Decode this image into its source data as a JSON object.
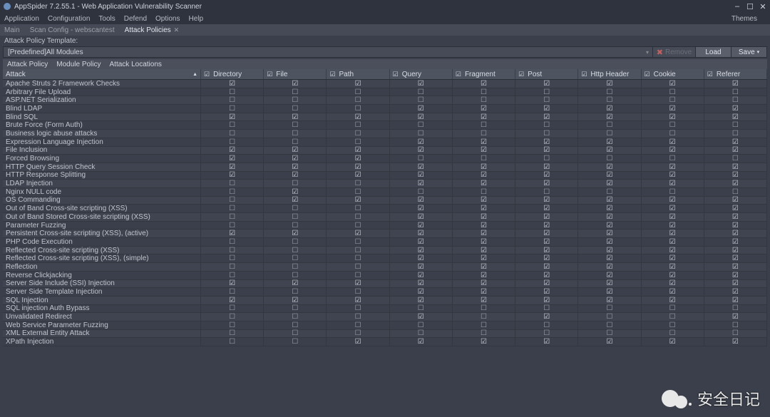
{
  "window": {
    "title": "AppSpider 7.2.55.1 - Web Application Vulnerability Scanner",
    "menus": [
      "Application",
      "Configuration",
      "Tools",
      "Defend",
      "Options",
      "Help"
    ],
    "themes_label": "Themes"
  },
  "tabs": [
    {
      "label": "Main",
      "active": false,
      "closable": false
    },
    {
      "label": "Scan Config - webscantest",
      "active": false,
      "closable": false
    },
    {
      "label": "Attack Policies",
      "active": true,
      "closable": true
    }
  ],
  "template": {
    "label": "Attack Policy Template:",
    "selected": "[Predefined]All Modules",
    "remove_label": "Remove",
    "load_label": "Load",
    "save_label": "Save"
  },
  "subtabs": [
    "Attack Policy",
    "Module Policy",
    "Attack Locations"
  ],
  "grid": {
    "attack_header": "Attack",
    "columns": [
      "Directory",
      "File",
      "Path",
      "Query",
      "Fragment",
      "Post",
      "Http Header",
      "Cookie",
      "Referer"
    ],
    "rows": [
      {
        "name": "Apache Struts 2 Framework Checks",
        "cells": [
          1,
          1,
          1,
          1,
          1,
          1,
          1,
          1,
          1
        ]
      },
      {
        "name": "Arbitrary File Upload",
        "cells": [
          0,
          0,
          0,
          0,
          0,
          0,
          0,
          0,
          0
        ]
      },
      {
        "name": "ASP.NET Serialization",
        "cells": [
          0,
          0,
          0,
          0,
          0,
          0,
          0,
          0,
          0
        ]
      },
      {
        "name": "Blind LDAP",
        "cells": [
          0,
          0,
          0,
          1,
          1,
          1,
          1,
          1,
          1
        ]
      },
      {
        "name": "Blind SQL",
        "cells": [
          1,
          1,
          1,
          1,
          1,
          1,
          1,
          1,
          1
        ]
      },
      {
        "name": "Brute Force (Form Auth)",
        "cells": [
          0,
          0,
          0,
          0,
          0,
          0,
          0,
          0,
          0
        ]
      },
      {
        "name": "Business logic abuse attacks",
        "cells": [
          0,
          0,
          0,
          0,
          0,
          0,
          0,
          0,
          0
        ]
      },
      {
        "name": "Expression Language Injection",
        "cells": [
          0,
          0,
          0,
          1,
          1,
          1,
          1,
          1,
          1
        ]
      },
      {
        "name": "File Inclusion",
        "cells": [
          1,
          1,
          1,
          1,
          1,
          1,
          1,
          1,
          1
        ]
      },
      {
        "name": "Forced Browsing",
        "cells": [
          1,
          1,
          1,
          0,
          0,
          0,
          0,
          0,
          0
        ]
      },
      {
        "name": "HTTP Query Session Check",
        "cells": [
          1,
          1,
          1,
          1,
          1,
          1,
          1,
          1,
          1
        ]
      },
      {
        "name": "HTTP Response Splitting",
        "cells": [
          1,
          1,
          1,
          1,
          1,
          1,
          1,
          1,
          1
        ]
      },
      {
        "name": "LDAP Injection",
        "cells": [
          0,
          0,
          0,
          1,
          1,
          1,
          1,
          1,
          1
        ]
      },
      {
        "name": "Nginx NULL code",
        "cells": [
          0,
          1,
          0,
          0,
          0,
          0,
          0,
          0,
          0
        ]
      },
      {
        "name": "OS Commanding",
        "cells": [
          0,
          1,
          1,
          1,
          1,
          1,
          1,
          1,
          1
        ]
      },
      {
        "name": "Out of Band Cross-site scripting (XSS)",
        "cells": [
          0,
          0,
          0,
          1,
          1,
          1,
          1,
          1,
          1
        ]
      },
      {
        "name": "Out of Band Stored Cross-site scripting (XSS)",
        "cells": [
          0,
          0,
          0,
          1,
          1,
          1,
          1,
          1,
          1
        ]
      },
      {
        "name": "Parameter Fuzzing",
        "cells": [
          0,
          0,
          0,
          1,
          1,
          1,
          1,
          1,
          1
        ]
      },
      {
        "name": "Persistent Cross-site scripting (XSS), (active)",
        "cells": [
          1,
          1,
          1,
          1,
          1,
          1,
          1,
          1,
          1
        ]
      },
      {
        "name": "PHP Code Execution",
        "cells": [
          0,
          0,
          0,
          1,
          1,
          1,
          1,
          1,
          1
        ]
      },
      {
        "name": "Reflected Cross-site scripting (XSS)",
        "cells": [
          0,
          0,
          0,
          1,
          1,
          1,
          1,
          1,
          1
        ]
      },
      {
        "name": "Reflected Cross-site scripting (XSS), (simple)",
        "cells": [
          0,
          0,
          0,
          1,
          1,
          1,
          1,
          1,
          1
        ]
      },
      {
        "name": "Reflection",
        "cells": [
          0,
          0,
          0,
          1,
          1,
          1,
          1,
          1,
          1
        ]
      },
      {
        "name": "Reverse Clickjacking",
        "cells": [
          0,
          0,
          0,
          1,
          1,
          1,
          1,
          1,
          1
        ]
      },
      {
        "name": "Server Side Include (SSI) Injection",
        "cells": [
          1,
          1,
          1,
          1,
          1,
          1,
          1,
          1,
          1
        ]
      },
      {
        "name": "Server Side Template Injection",
        "cells": [
          0,
          0,
          0,
          1,
          1,
          1,
          1,
          1,
          1
        ]
      },
      {
        "name": "SQL Injection",
        "cells": [
          1,
          1,
          1,
          1,
          1,
          1,
          1,
          1,
          1
        ]
      },
      {
        "name": "SQL injection Auth Bypass",
        "cells": [
          0,
          0,
          0,
          0,
          0,
          0,
          0,
          0,
          0
        ]
      },
      {
        "name": "Unvalidated Redirect",
        "cells": [
          0,
          0,
          0,
          1,
          0,
          1,
          0,
          0,
          1
        ]
      },
      {
        "name": "Web Service Parameter Fuzzing",
        "cells": [
          0,
          0,
          0,
          0,
          0,
          0,
          0,
          0,
          0
        ]
      },
      {
        "name": "XML External Entity Attack",
        "cells": [
          0,
          0,
          0,
          0,
          0,
          0,
          0,
          0,
          0
        ]
      },
      {
        "name": "XPath Injection",
        "cells": [
          0,
          0,
          1,
          1,
          1,
          1,
          1,
          1,
          1
        ]
      }
    ]
  },
  "watermark": "安全日记"
}
